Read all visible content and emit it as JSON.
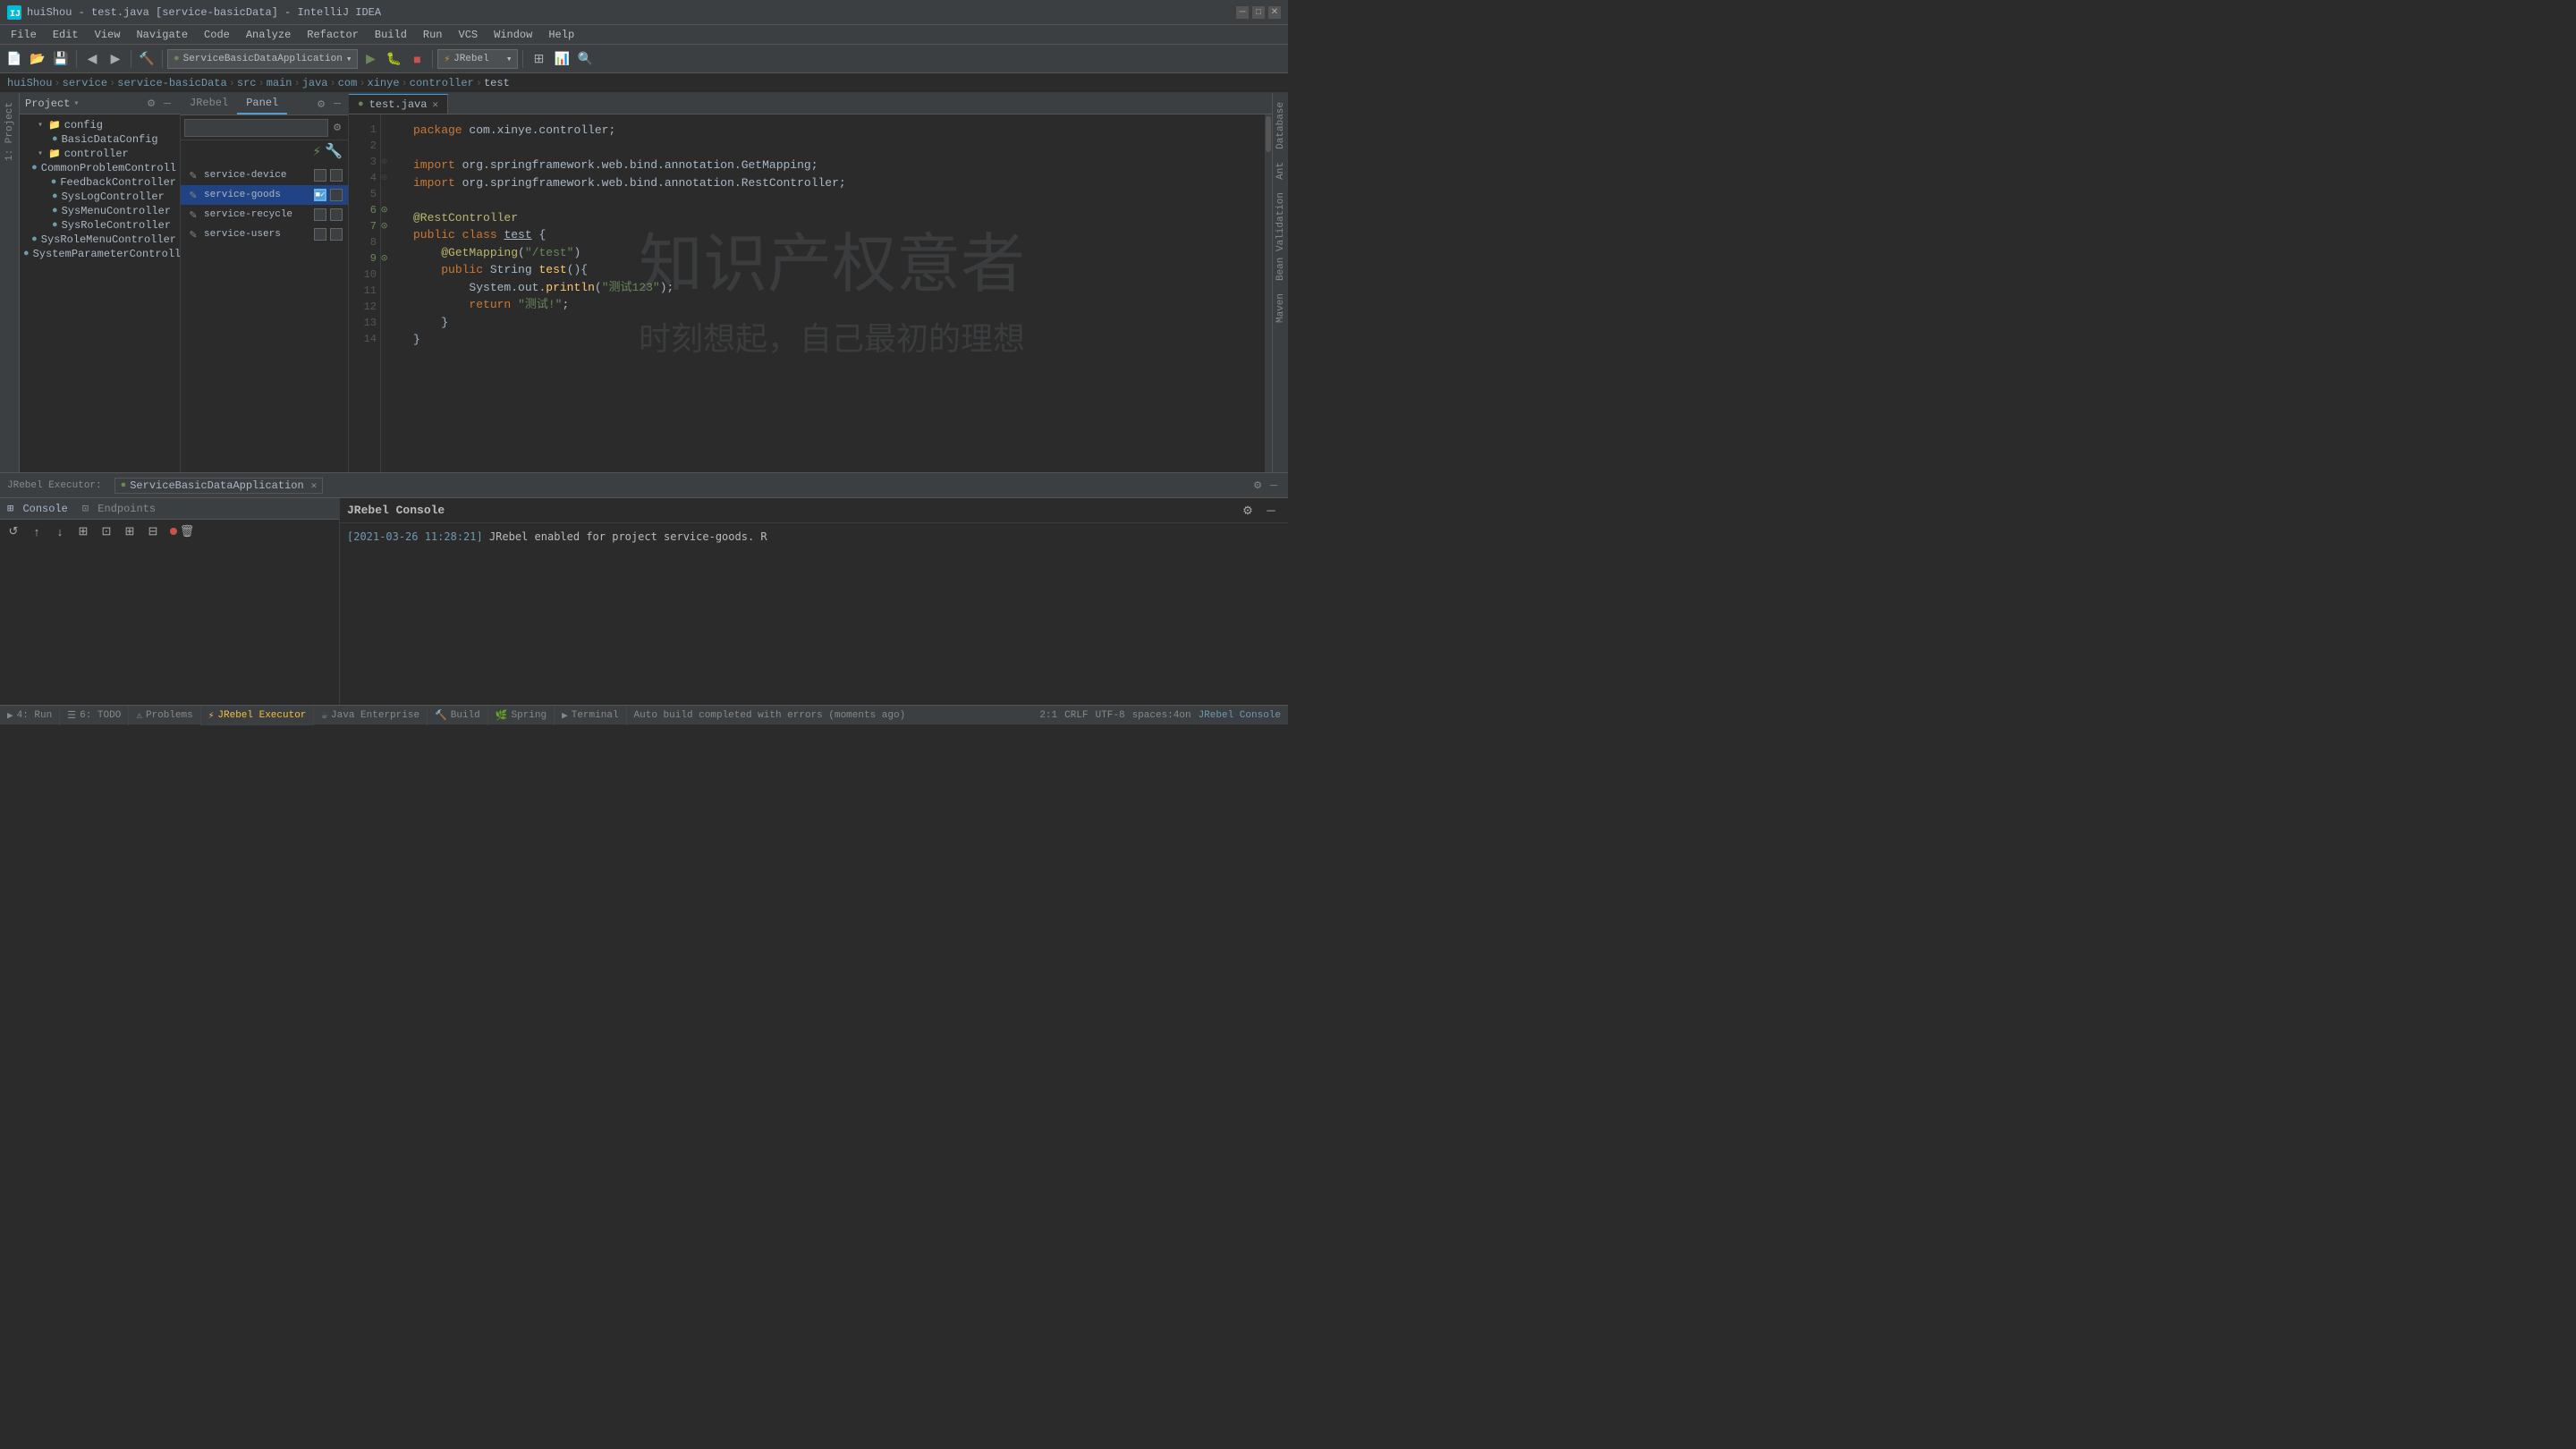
{
  "window": {
    "title": "huiShou - test.java [service-basicData] - IntelliJ IDEA",
    "controls": [
      "minimize",
      "maximize",
      "close"
    ]
  },
  "menu": {
    "items": [
      "File",
      "Edit",
      "View",
      "Navigate",
      "Code",
      "Analyze",
      "Refactor",
      "Build",
      "Run",
      "VCS",
      "Window",
      "Help"
    ]
  },
  "toolbar": {
    "run_config": "ServiceBasicDataApplication",
    "run_profile": "JRebel"
  },
  "breadcrumb": {
    "items": [
      "huiShou",
      "service",
      "service-basicData",
      "src",
      "main",
      "java",
      "com",
      "xinye",
      "controller",
      "test"
    ]
  },
  "project_panel": {
    "title": "Project",
    "items": [
      {
        "name": "config",
        "type": "folder",
        "indent": 1
      },
      {
        "name": "BasicDataConfig",
        "type": "java",
        "indent": 2
      },
      {
        "name": "controller",
        "type": "folder",
        "indent": 1
      },
      {
        "name": "CommonProblemControll",
        "type": "java",
        "indent": 2
      },
      {
        "name": "FeedbackController",
        "type": "java",
        "indent": 2
      },
      {
        "name": "SysLogController",
        "type": "java",
        "indent": 2
      },
      {
        "name": "SysMenuController",
        "type": "java",
        "indent": 2
      },
      {
        "name": "SysRoleController",
        "type": "java",
        "indent": 2
      },
      {
        "name": "SysRoleMenuController",
        "type": "java",
        "indent": 2
      },
      {
        "name": "SystemParameterControll",
        "type": "java",
        "indent": 2
      }
    ]
  },
  "jrebel_panel": {
    "tabs": [
      "JRebel",
      "Panel"
    ],
    "active_tab": "Panel",
    "rows": [
      {
        "name": "service-device",
        "checked1": false,
        "checked2": false,
        "active": false
      },
      {
        "name": "service-goods",
        "checked1": true,
        "checked2": false,
        "active": true
      },
      {
        "name": "service-recycle",
        "checked1": false,
        "checked2": false,
        "active": false
      },
      {
        "name": "service-users",
        "checked1": false,
        "checked2": false,
        "active": false
      }
    ]
  },
  "editor": {
    "tab": "test.java",
    "lines": [
      {
        "num": 1,
        "text": "package com.xinye.controller;"
      },
      {
        "num": 2,
        "text": ""
      },
      {
        "num": 3,
        "text": "import org.springframework.web.bind.annotation.GetMapping;"
      },
      {
        "num": 4,
        "text": "import org.springframework.web.bind.annotation.RestController;"
      },
      {
        "num": 5,
        "text": ""
      },
      {
        "num": 6,
        "text": "@RestController"
      },
      {
        "num": 7,
        "text": "public class test {"
      },
      {
        "num": 8,
        "text": "    @GetMapping(\"/test\")"
      },
      {
        "num": 9,
        "text": "    public String test(){"
      },
      {
        "num": 10,
        "text": "        System.out.println(\"测试123\");"
      },
      {
        "num": 11,
        "text": "        return \"测试!\";"
      },
      {
        "num": 12,
        "text": "    }"
      },
      {
        "num": 13,
        "text": "}"
      },
      {
        "num": 14,
        "text": ""
      }
    ],
    "watermark1": "知识产权意者",
    "watermark2": "时刻想起，自己最初的理想"
  },
  "bottom_panel": {
    "executor_label": "JRebel Executor:",
    "executor_app": "ServiceBasicDataApplication",
    "console_tab": "Console",
    "endpoints_tab": "Endpoints",
    "jrebel_console_title": "JRebel Console",
    "console_log": "[2021-03-26 11:28:21] JRebel enabled for project service-goods. R"
  },
  "status_bar": {
    "message": "Auto build completed with errors (moments ago)",
    "items": [
      "4: Run",
      "6: TODO",
      "Problems",
      "JRebel Executor",
      "Java Enterprise",
      "Build",
      "Spring",
      "Terminal"
    ],
    "right_items": [
      "2:1",
      "CRLF",
      "UTF-8",
      "spaces:4on",
      "JRebel Console"
    ]
  },
  "right_sidebar": {
    "tabs": [
      "Database",
      "Ant",
      "Bean Validation",
      "Maven"
    ]
  }
}
